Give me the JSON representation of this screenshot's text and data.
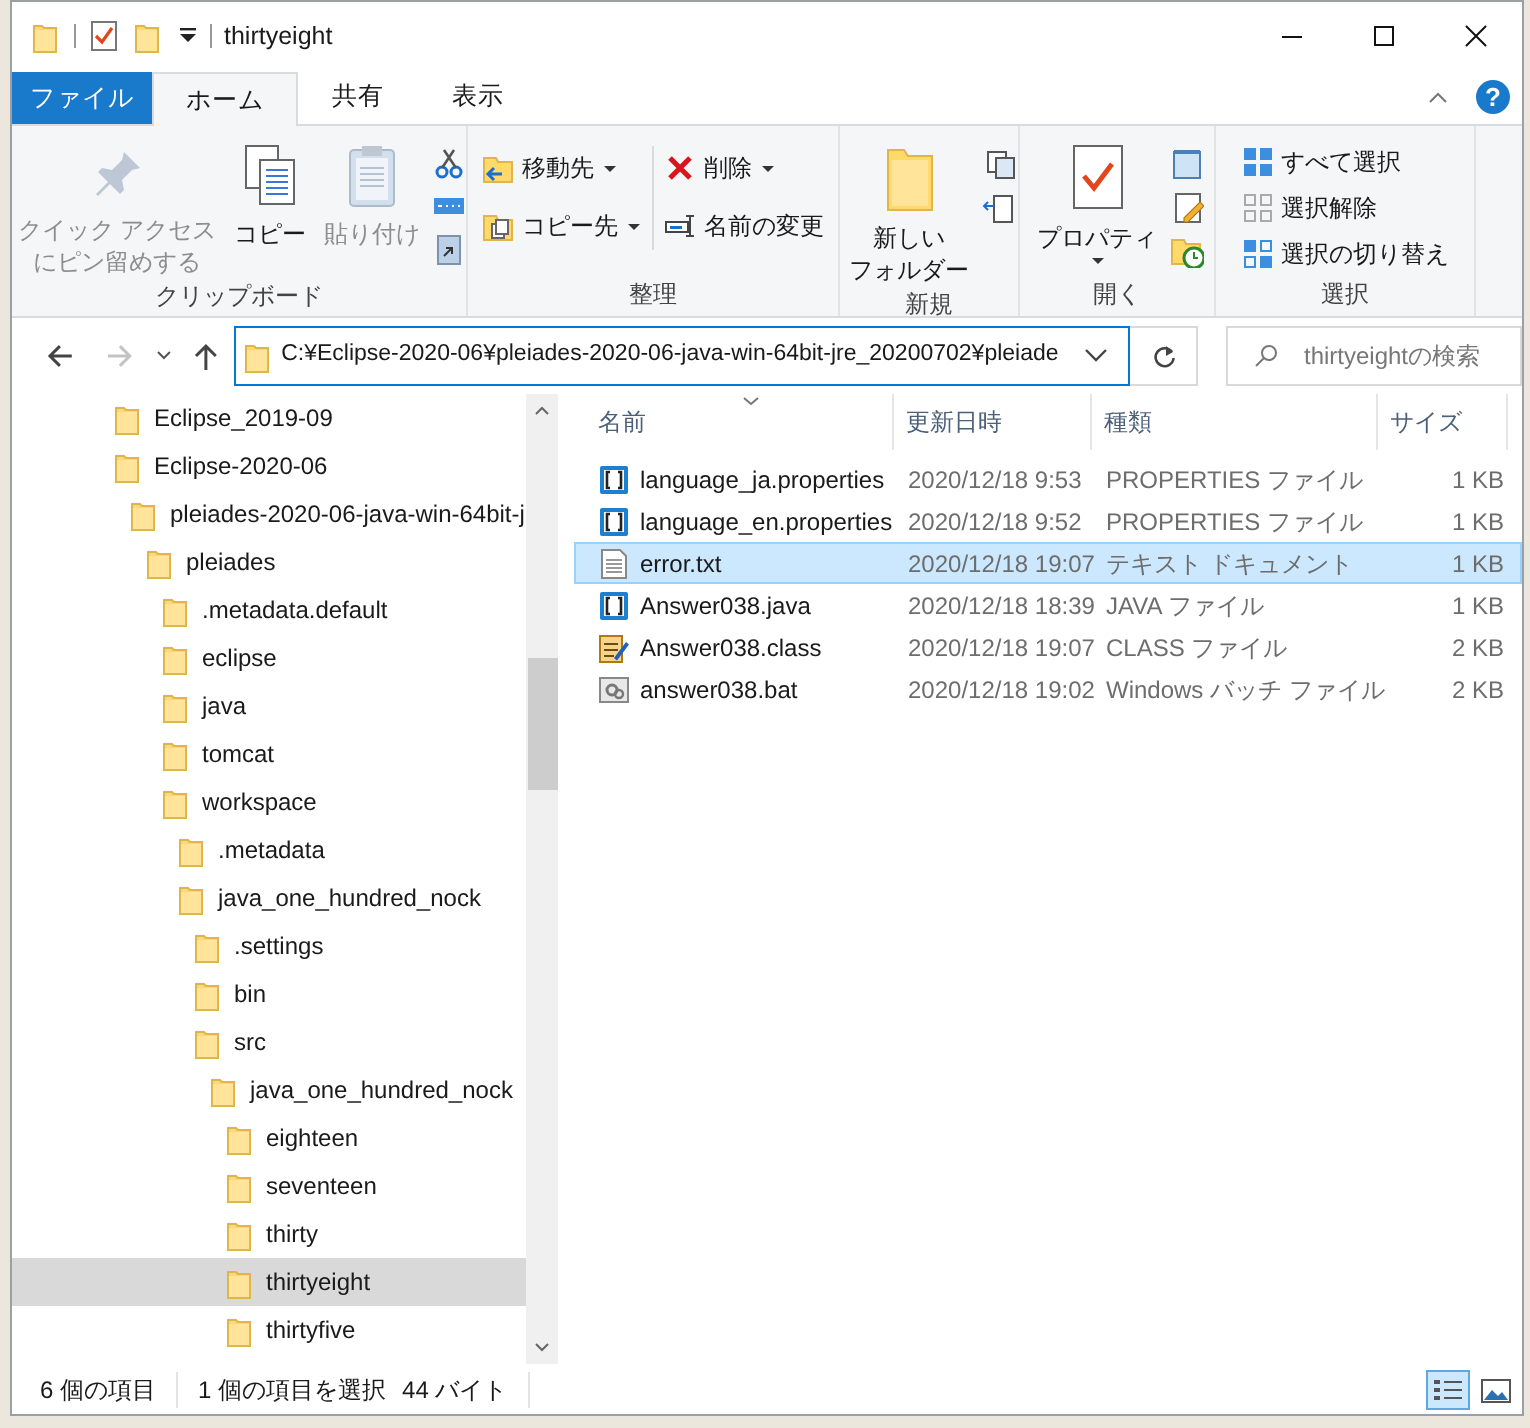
{
  "window": {
    "title": "thirtyeight"
  },
  "ribbon_tabs": [
    {
      "label": "ファイル",
      "kind": "file",
      "selected": false
    },
    {
      "label": "ホーム",
      "kind": "tab",
      "selected": true
    },
    {
      "label": "共有",
      "kind": "tab",
      "selected": false
    },
    {
      "label": "表示",
      "kind": "tab",
      "selected": false
    }
  ],
  "help": "?",
  "ribbon_groups": [
    {
      "label": "クリップボード",
      "items": [
        {
          "kind": "large",
          "lines": [
            "クイック アクセス",
            "にピン留めする"
          ],
          "disabled": true
        },
        {
          "kind": "large",
          "lines": [
            "コピー"
          ],
          "disabled": false
        },
        {
          "kind": "large",
          "lines": [
            "貼り付け"
          ],
          "disabled": true
        }
      ]
    },
    {
      "label": "整理",
      "items": [
        {
          "kind": "small",
          "label": "移動先",
          "dropdown": true
        },
        {
          "kind": "small",
          "label": "コピー先",
          "dropdown": true
        },
        {
          "kind": "small",
          "label": "削除",
          "dropdown": true
        },
        {
          "kind": "small",
          "label": "名前の変更",
          "dropdown": false
        }
      ]
    },
    {
      "label": "新規",
      "items": [
        {
          "kind": "large",
          "lines": [
            "新しい",
            "フォルダー"
          ],
          "disabled": false
        }
      ]
    },
    {
      "label": "開く",
      "items": [
        {
          "kind": "large",
          "lines": [
            "プロパティ"
          ],
          "disabled": false
        }
      ]
    },
    {
      "label": "選択",
      "items": [
        {
          "kind": "small",
          "label": "すべて選択",
          "dropdown": false
        },
        {
          "kind": "small",
          "label": "選択解除",
          "dropdown": false
        },
        {
          "kind": "small",
          "label": "選択の切り替え",
          "dropdown": false
        }
      ]
    }
  ],
  "address": {
    "path": "C:¥Eclipse-2020-06¥pleiades-2020-06-java-win-64bit-jre_20200702¥pleiade"
  },
  "search": {
    "placeholder": "thirtyeightの検索"
  },
  "tree": [
    {
      "label": "Eclipse_2019-09",
      "selected": false
    },
    {
      "label": "Eclipse-2020-06",
      "selected": false,
      "children": [
        {
          "label": "pleiades-2020-06-java-win-64bit-j",
          "selected": false,
          "children": [
            {
              "label": "pleiades",
              "selected": false,
              "children": [
                {
                  "label": ".metadata.default",
                  "selected": false
                },
                {
                  "label": "eclipse",
                  "selected": false
                },
                {
                  "label": "java",
                  "selected": false
                },
                {
                  "label": "tomcat",
                  "selected": false
                },
                {
                  "label": "workspace",
                  "selected": false,
                  "children": [
                    {
                      "label": ".metadata",
                      "selected": false
                    },
                    {
                      "label": "java_one_hundred_nock",
                      "selected": false,
                      "children": [
                        {
                          "label": ".settings",
                          "selected": false
                        },
                        {
                          "label": "bin",
                          "selected": false
                        },
                        {
                          "label": "src",
                          "selected": false,
                          "children": [
                            {
                              "label": "java_one_hundred_nock",
                              "selected": false,
                              "children": [
                                {
                                  "label": "eighteen",
                                  "selected": false
                                },
                                {
                                  "label": "seventeen",
                                  "selected": false
                                },
                                {
                                  "label": "thirty",
                                  "selected": false
                                },
                                {
                                  "label": "thirtyeight",
                                  "selected": true
                                },
                                {
                                  "label": "thirtyfive",
                                  "selected": false
                                }
                              ]
                            }
                          ]
                        }
                      ]
                    }
                  ]
                }
              ]
            }
          ]
        }
      ]
    }
  ],
  "file_columns": [
    "名前",
    "更新日時",
    "種類",
    "サイズ"
  ],
  "files": [
    {
      "kind": "properties",
      "name": "language_ja.properties",
      "modified": "2020/12/18 9:53",
      "type": "PROPERTIES ファイル",
      "size": "1 KB",
      "selected": false
    },
    {
      "kind": "properties",
      "name": "language_en.properties",
      "modified": "2020/12/18 9:52",
      "type": "PROPERTIES ファイル",
      "size": "1 KB",
      "selected": false
    },
    {
      "kind": "text",
      "name": "error.txt",
      "modified": "2020/12/18 19:07",
      "type": "テキスト ドキュメント",
      "size": "1 KB",
      "selected": true
    },
    {
      "kind": "properties",
      "name": "Answer038.java",
      "modified": "2020/12/18 18:39",
      "type": "JAVA ファイル",
      "size": "1 KB",
      "selected": false
    },
    {
      "kind": "class",
      "name": "Answer038.class",
      "modified": "2020/12/18 19:07",
      "type": "CLASS ファイル",
      "size": "2 KB",
      "selected": false
    },
    {
      "kind": "batch",
      "name": "answer038.bat",
      "modified": "2020/12/18 19:02",
      "type": "Windows バッチ ファイル",
      "size": "2 KB",
      "selected": false
    }
  ],
  "status_bar": {
    "item_count": "6 個の項目",
    "selection": "1 個の項目を選択",
    "selection_size": "44 バイト"
  },
  "views": [
    {
      "selected": true
    },
    {
      "selected": false
    }
  ]
}
